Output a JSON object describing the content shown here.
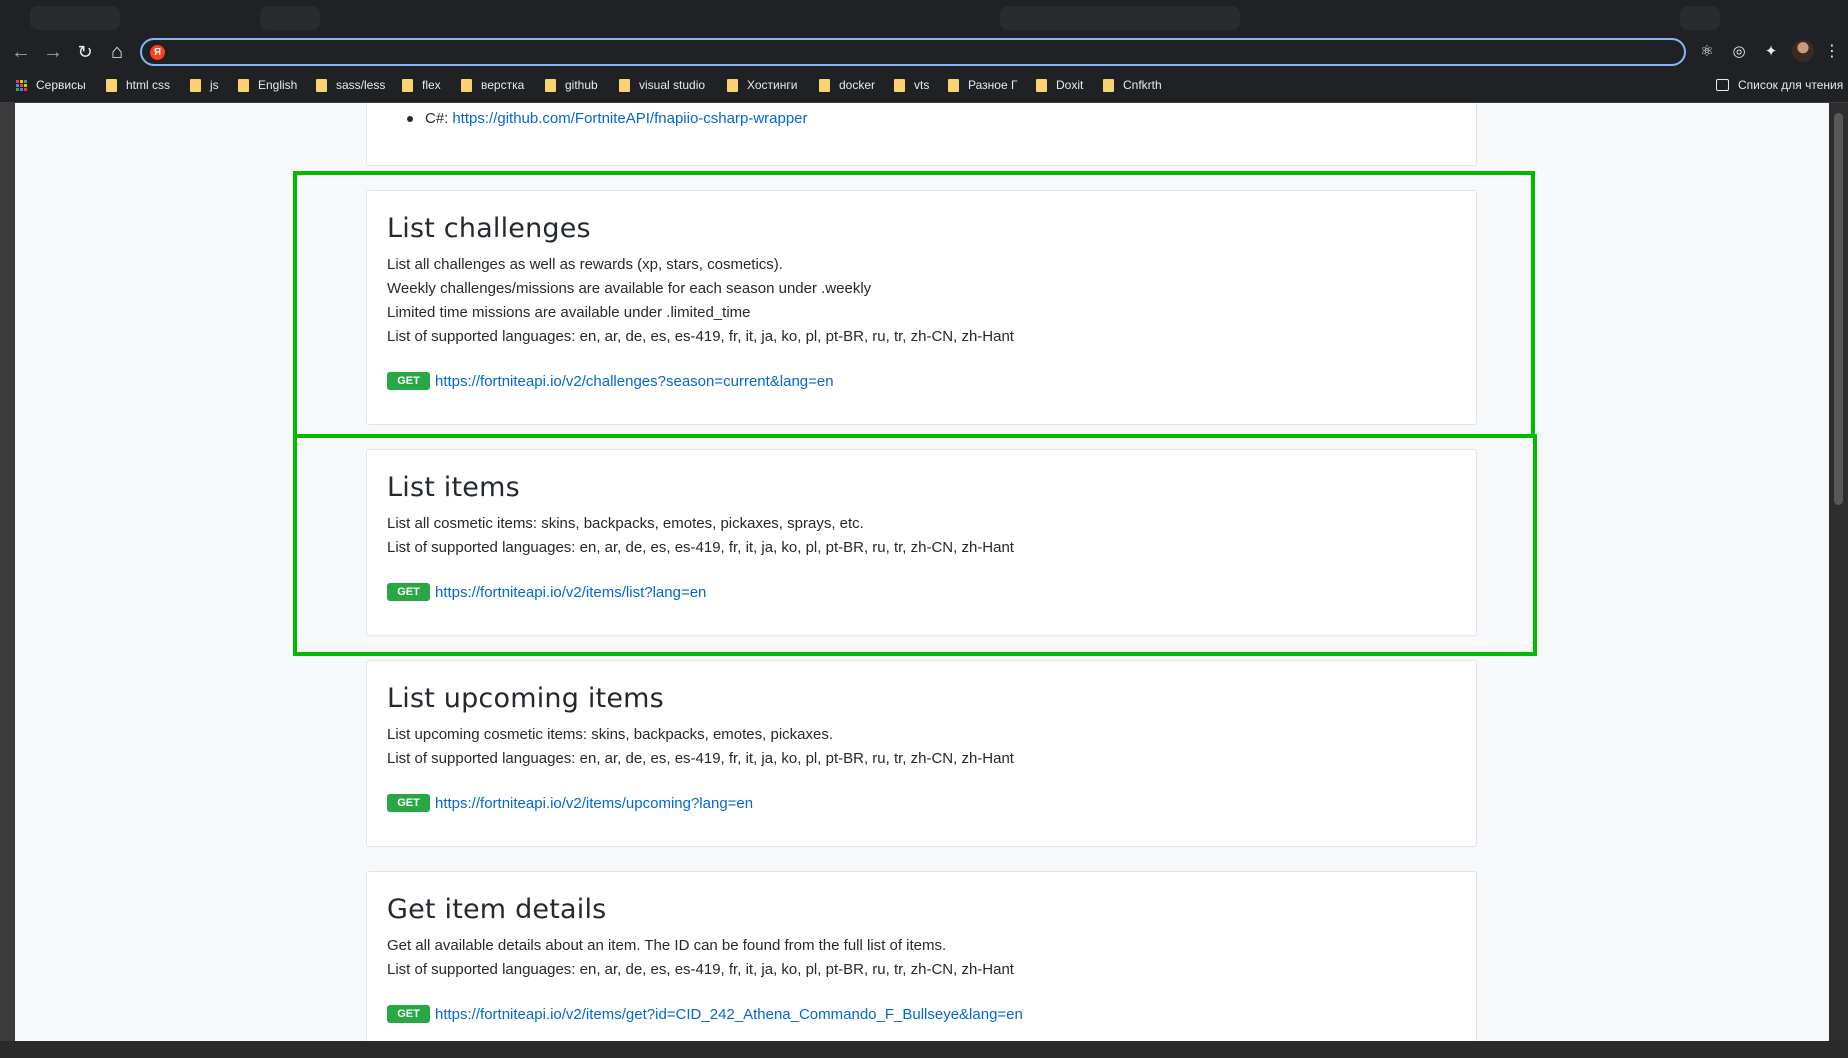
{
  "browser": {
    "address_value": "",
    "bookmarks": [
      {
        "label": "Сервисы",
        "kind": "apps"
      },
      {
        "label": "html css",
        "kind": "folder"
      },
      {
        "label": "js",
        "kind": "folder"
      },
      {
        "label": "English",
        "kind": "folder"
      },
      {
        "label": "sass/less",
        "kind": "folder"
      },
      {
        "label": "flex",
        "kind": "folder"
      },
      {
        "label": "верстка",
        "kind": "folder"
      },
      {
        "label": "github",
        "kind": "folder"
      },
      {
        "label": "visual studio",
        "kind": "folder"
      },
      {
        "label": "Хостинги",
        "kind": "folder"
      },
      {
        "label": "docker",
        "kind": "folder"
      },
      {
        "label": "vts",
        "kind": "folder"
      },
      {
        "label": "Разное Г",
        "kind": "folder"
      },
      {
        "label": "Doxit",
        "kind": "folder"
      },
      {
        "label": "Cnfkrth",
        "kind": "folder"
      }
    ],
    "reading_list_label": "Список для чтения",
    "colors": {
      "chrome_bg": "#202124",
      "focus_ring": "#8ab4f8",
      "folder": "#f9d371"
    }
  },
  "page": {
    "top_list_item": {
      "prefix": "C#:",
      "link": "https://github.com/FortniteAPI/fnapiio-csharp-wrapper"
    },
    "method_label": "GET",
    "sections": [
      {
        "title": "List challenges",
        "lines": [
          "List all challenges as well as rewards (xp, stars, cosmetics).",
          "Weekly challenges/missions are available for each season under .weekly",
          "Limited time missions are available under .limited_time",
          "List of supported languages: en, ar, de, es, es-419, fr, it, ja, ko, pl, pt-BR, ru, tr, zh-CN, zh-Hant"
        ],
        "url": "https://fortniteapi.io/v2/challenges?season=current&lang=en"
      },
      {
        "title": "List items",
        "lines": [
          "List all cosmetic items: skins, backpacks, emotes, pickaxes, sprays, etc.",
          "List of supported languages: en, ar, de, es, es-419, fr, it, ja, ko, pl, pt-BR, ru, tr, zh-CN, zh-Hant"
        ],
        "url": "https://fortniteapi.io/v2/items/list?lang=en"
      },
      {
        "title": "List upcoming items",
        "lines": [
          "List upcoming cosmetic items: skins, backpacks, emotes, pickaxes.",
          "List of supported languages: en, ar, de, es, es-419, fr, it, ja, ko, pl, pt-BR, ru, tr, zh-CN, zh-Hant"
        ],
        "url": "https://fortniteapi.io/v2/items/upcoming?lang=en"
      },
      {
        "title": "Get item details",
        "lines": [
          "Get all available details about an item. The ID can be found from the full list of items.",
          "List of supported languages: en, ar, de, es, es-419, fr, it, ja, ko, pl, pt-BR, ru, tr, zh-CN, zh-Hant"
        ],
        "url": "https://fortniteapi.io/v2/items/get?id=CID_242_Athena_Commando_F_Bullseye&lang=en"
      }
    ],
    "colors": {
      "badge": "#28a745",
      "link": "#0366d6",
      "highlight": "#00bb00",
      "text": "#24292e"
    }
  }
}
